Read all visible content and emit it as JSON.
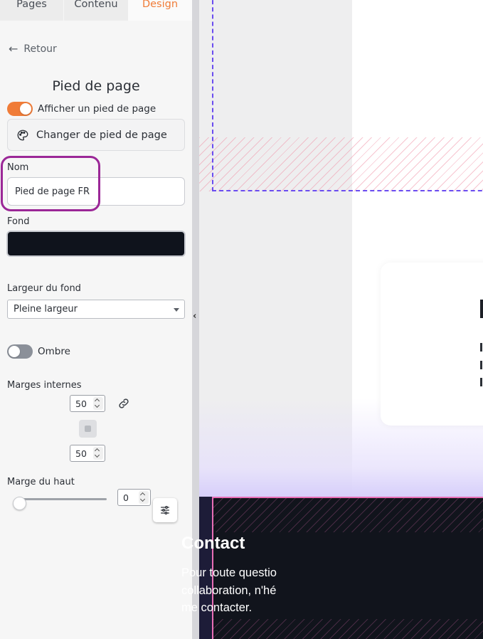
{
  "tabs": [
    {
      "label": "Pages"
    },
    {
      "label": "Contenu"
    },
    {
      "label": "Design"
    }
  ],
  "back": {
    "label": "Retour",
    "icon": "arrow-left-icon"
  },
  "section_title": "Pied de page",
  "footer_toggle": {
    "label": "Afficher un pied de page",
    "checked": true
  },
  "change_footer": {
    "label": "Changer de pied de page",
    "icon": "palette-icon"
  },
  "name_field": {
    "label": "Nom",
    "value": "Pied de page FR"
  },
  "background": {
    "label": "Fond",
    "color": "#0f131c"
  },
  "background_width": {
    "label": "Largeur du fond",
    "selected": "Pleine largeur"
  },
  "shadow_toggle": {
    "label": "Ombre",
    "checked": false
  },
  "padding": {
    "label": "Marges internes",
    "top": "50",
    "bottom": "50",
    "icon": "link-icon"
  },
  "top_margin": {
    "label": "Marge du haut",
    "value": "0"
  },
  "preview": {
    "contact_title": "Contact",
    "contact_text": "Pour toute questio\ncollaboration, n'hé\nme contacter."
  },
  "colors": {
    "accent": "#f07c38",
    "highlight": "#9b2797",
    "dashed_outline": "#6a4cf0",
    "footer_outline": "#e86eb5"
  }
}
